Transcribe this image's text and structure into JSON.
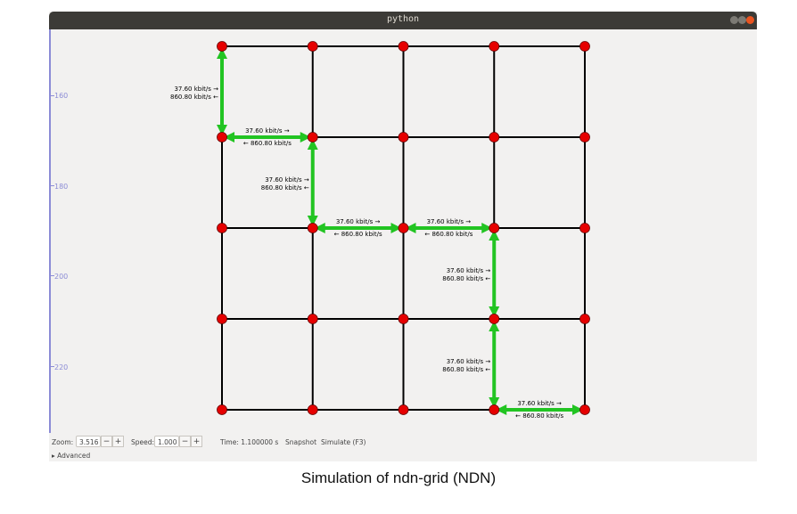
{
  "window": {
    "title": "python"
  },
  "ruler": {
    "labels": [
      "160",
      "180",
      "200",
      "220"
    ]
  },
  "controls": {
    "zoom_label": "Zoom:",
    "zoom_value": "3.516",
    "speed_label": "Speed:",
    "speed_value": "1.000",
    "minus": "−",
    "plus": "+",
    "time_label": "Time: 1.100000 s",
    "snapshot_label": "Snapshot",
    "simulate_label": "Simulate (F3)",
    "advanced_label": "Advanced",
    "advanced_icon": "triangle-right-icon"
  },
  "graph": {
    "rows": 5,
    "cols": 5,
    "node_color": "#e60000",
    "edge_color": "#000000",
    "flow_color": "#22c422",
    "flows": [
      {
        "from": [
          0,
          1
        ],
        "to": [
          0,
          0
        ],
        "label_a": "37.60 kbit/s →",
        "label_b": "860.80 kbit/s ←"
      },
      {
        "from": [
          0,
          1
        ],
        "to": [
          1,
          1
        ],
        "label_a": "37.60 kbit/s →",
        "label_b": "← 860.80 kbit/s"
      },
      {
        "from": [
          1,
          1
        ],
        "to": [
          1,
          2
        ],
        "label_a": "37.60 kbit/s →",
        "label_b": "860.80 kbit/s ←"
      },
      {
        "from": [
          1,
          2
        ],
        "to": [
          2,
          2
        ],
        "label_a": "37.60 kbit/s →",
        "label_b": "← 860.80 kbit/s"
      },
      {
        "from": [
          2,
          2
        ],
        "to": [
          3,
          2
        ],
        "label_a": "37.60 kbit/s →",
        "label_b": "← 860.80 kbit/s"
      },
      {
        "from": [
          3,
          2
        ],
        "to": [
          3,
          3
        ],
        "label_a": "37.60 kbit/s →",
        "label_b": "860.80 kbit/s ←"
      },
      {
        "from": [
          3,
          3
        ],
        "to": [
          3,
          4
        ],
        "label_a": "37.60 kbit/s →",
        "label_b": "860.80 kbit/s ←"
      },
      {
        "from": [
          3,
          4
        ],
        "to": [
          4,
          4
        ],
        "label_a": "37.60 kbit/s →",
        "label_b": "← 860.80 kbit/s"
      }
    ]
  },
  "caption": "Simulation of ndn-grid (NDN)"
}
